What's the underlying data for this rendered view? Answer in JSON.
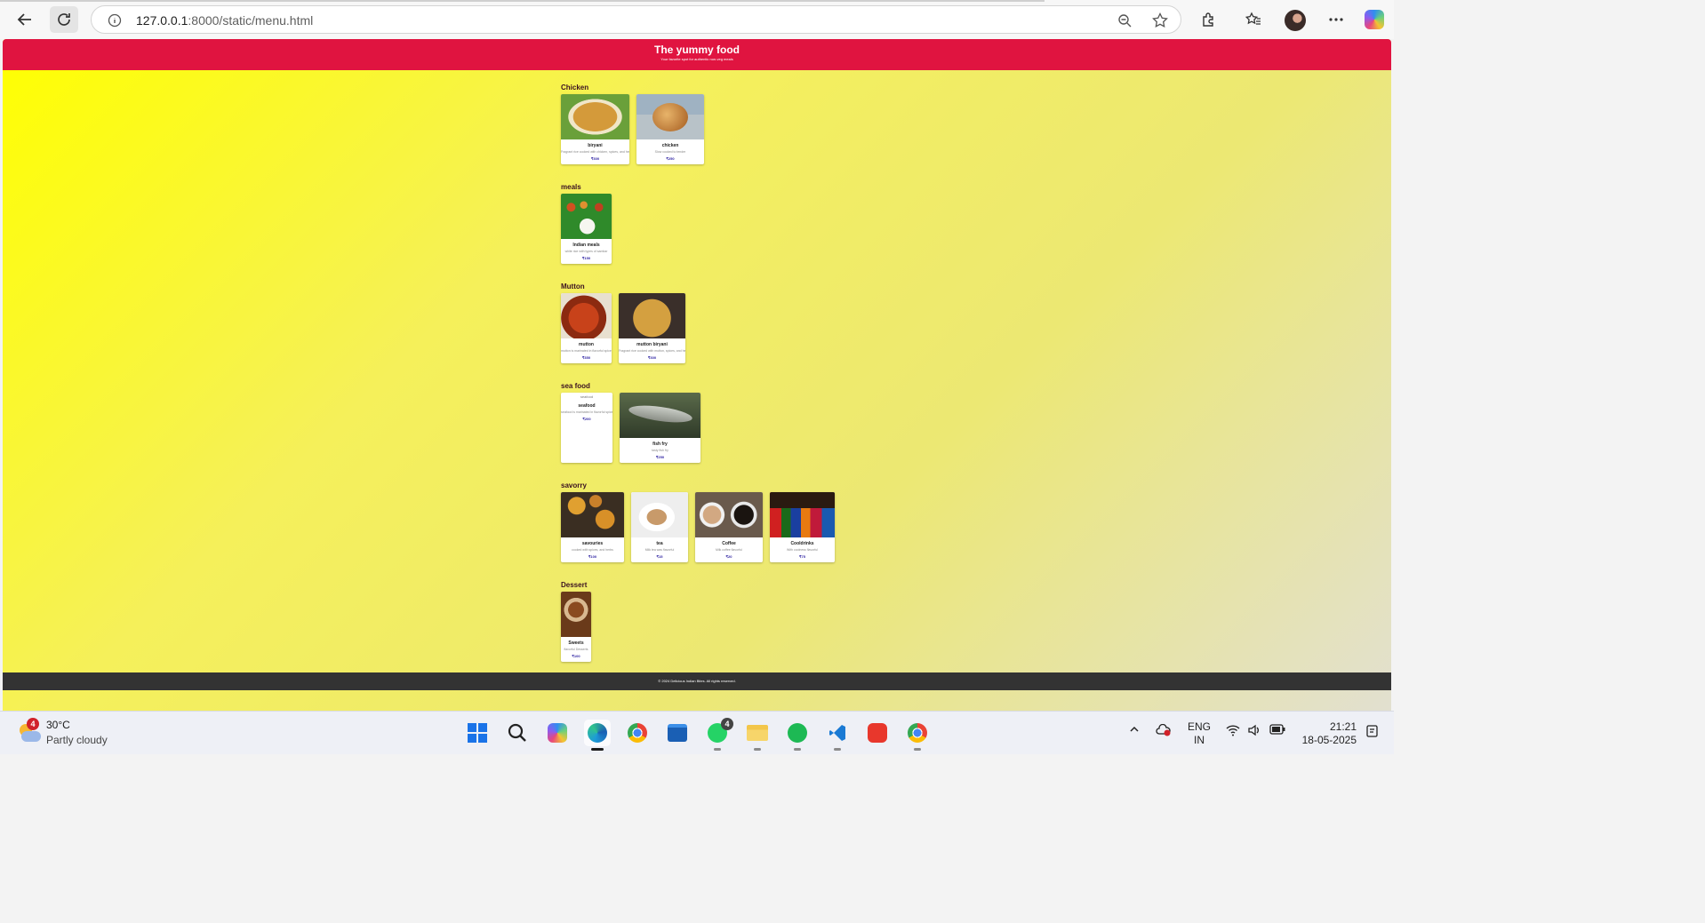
{
  "browser": {
    "url_host": "127.0.0.1",
    "url_path": ":8000/static/menu.html"
  },
  "site": {
    "title": "The yummy food",
    "tagline": "Your favorite spot for authentic non-veg meals",
    "footer": "© 2024 Delicious Indian Bites. All rights reserved."
  },
  "menu": [
    {
      "category": "Chicken",
      "items": [
        {
          "name": "biryani",
          "desc": "Fragrant rice cooked with chicken, spices, and herbs.",
          "price": "₹300"
        },
        {
          "name": "chicken",
          "desc": "Slow cooked to tender",
          "price": "₹250"
        }
      ]
    },
    {
      "category": "meals",
      "items": [
        {
          "name": "Indian meals",
          "desc": "white rice with types of sambar",
          "price": "₹150"
        }
      ]
    },
    {
      "category": "Mutton",
      "items": [
        {
          "name": "mutton",
          "desc": "mutton is marinated in flavorful spices",
          "price": "₹350"
        },
        {
          "name": "mutton biryani",
          "desc": "Fragrant rice cooked with mutton, spices, and herbs.",
          "price": "₹300"
        }
      ]
    },
    {
      "category": "sea food",
      "items": [
        {
          "name": "seafood",
          "alt": "seafood",
          "desc": "seafood is marinated in flavorful spices",
          "price": "₹200"
        },
        {
          "name": "fish fry",
          "desc": "tasty fish fry",
          "price": "₹250"
        }
      ]
    },
    {
      "category": "savorry",
      "items": [
        {
          "name": "savouries",
          "desc": "cooked with spices, and herbs",
          "price": "₹100"
        },
        {
          "name": "tea",
          "desc": "Milk tea was flavorful",
          "price": "₹15"
        },
        {
          "name": "Coffee",
          "desc": "Milk coffee flavorful",
          "price": "₹20"
        },
        {
          "name": "Cooldrinks",
          "desc": "With coolness flavorful",
          "price": "₹75"
        }
      ]
    },
    {
      "category": "Dessert",
      "items": [
        {
          "name": "Sweets",
          "desc": "flavorful Desserts",
          "price": "₹100"
        }
      ]
    }
  ],
  "taskbar": {
    "weather_temp": "30°C",
    "weather_desc": "Partly cloudy",
    "weather_badge": "4",
    "whatsapp_badge": "4",
    "lang_line1": "ENG",
    "lang_line2": "IN",
    "time": "21:21",
    "date": "18-05-2025"
  },
  "colors": {
    "header_bg": "#e01440",
    "footer_bg": "#333333",
    "price_text": "#2a1ea0"
  }
}
